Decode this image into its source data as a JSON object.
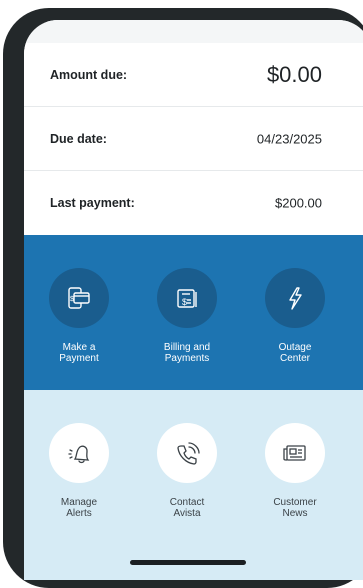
{
  "account": {
    "amount_due_label": "Amount due:",
    "amount_due_value": "$0.00",
    "due_date_label": "Due date:",
    "due_date_value": "04/23/2025",
    "last_payment_label": "Last payment:",
    "last_payment_value": "$200.00"
  },
  "primary_actions": [
    {
      "label": "Make a\nPayment",
      "icon": "payment-card-icon"
    },
    {
      "label": "Billing and\nPayments",
      "icon": "bill-icon"
    },
    {
      "label": "Outage\nCenter",
      "icon": "lightning-icon"
    }
  ],
  "secondary_actions": [
    {
      "label": "Manage\nAlerts",
      "icon": "bell-icon"
    },
    {
      "label": "Contact\nAvista",
      "icon": "phone-icon"
    },
    {
      "label": "Customer\nNews",
      "icon": "newspaper-icon"
    }
  ],
  "colors": {
    "primary_blue": "#1d74b1",
    "icon_circle_dark": "#1a5d8e",
    "light_section": "#d6ebf5"
  }
}
